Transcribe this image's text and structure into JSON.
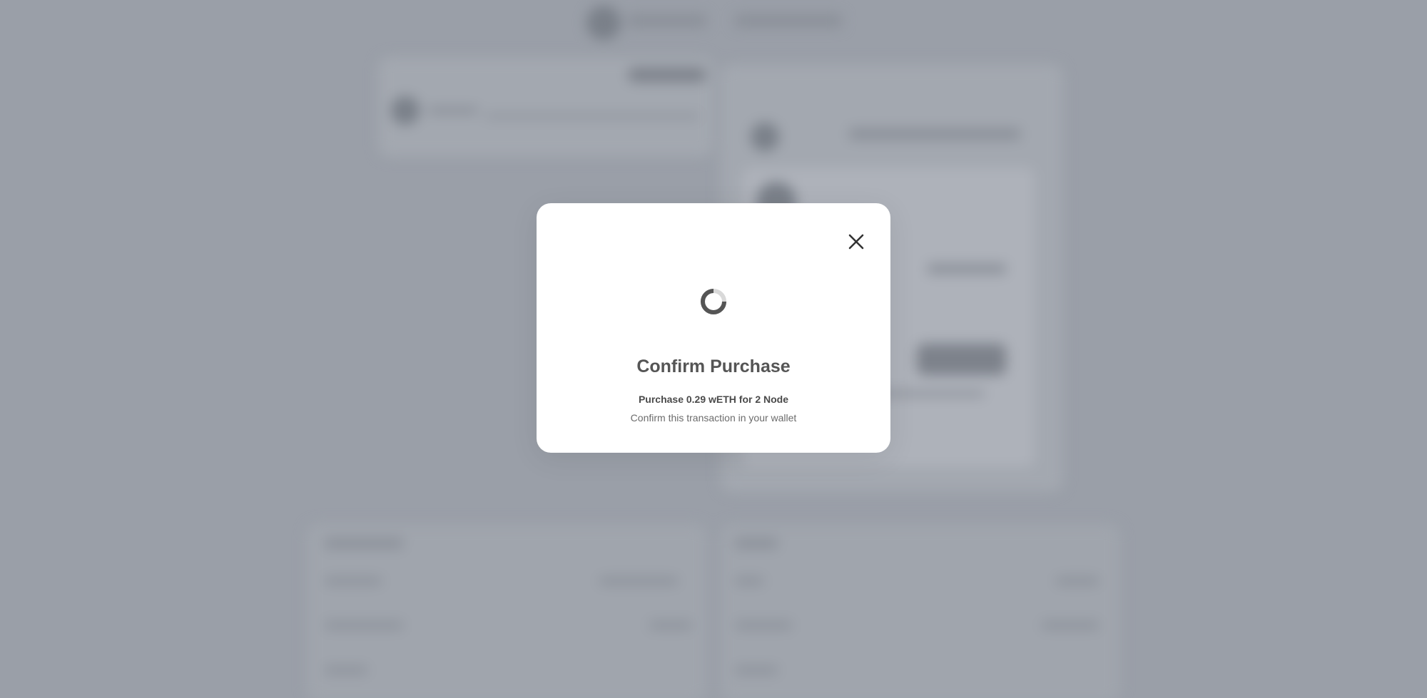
{
  "modal": {
    "title": "Confirm Purchase",
    "detail": "Purchase 0.29 wETH for 2 Node",
    "hint": "Confirm this transaction in your wallet",
    "close_icon": "close-icon",
    "spinner_icon": "loading-spinner-icon"
  },
  "colors": {
    "overlay": "#9a9fa8",
    "modal_bg": "#ffffff",
    "title": "#555555",
    "detail": "#4a4a4a",
    "hint": "#6b6b6b"
  }
}
